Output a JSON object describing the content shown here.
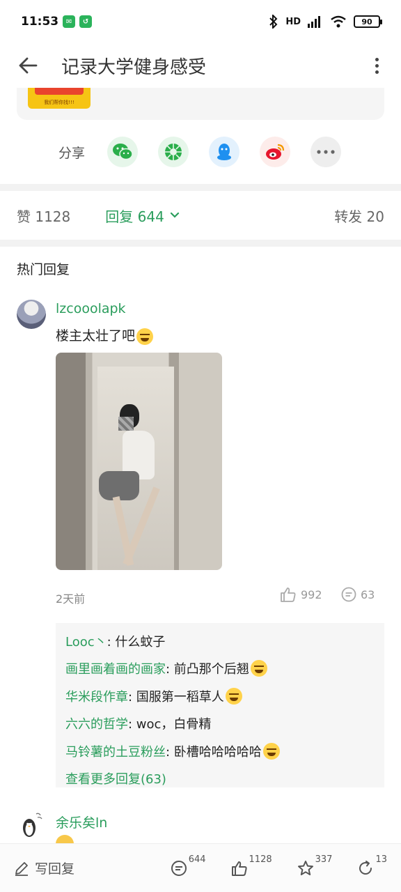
{
  "status_bar": {
    "time": "11:53",
    "network": "HD",
    "battery": "90"
  },
  "header": {
    "title": "记录大学健身感受"
  },
  "top_card": {
    "thumb_text": "我们帮你找!!!"
  },
  "share": {
    "label": "分享",
    "targets": [
      "wechat-icon",
      "moments-icon",
      "qq-icon",
      "weibo-icon",
      "more-icon"
    ]
  },
  "tabs": {
    "likes": "赞 1128",
    "replies": "回复 644",
    "forwards": "转发 20"
  },
  "section": {
    "hot_replies": "热门回复"
  },
  "comments": [
    {
      "username": "lzcooolapk",
      "text": "楼主太壮了吧",
      "time": "2天前",
      "likes": "992",
      "reply_count": "63",
      "replies": [
        {
          "name": "Looc丶",
          "text": ": 什么蚊子"
        },
        {
          "name": "画里画着画的画家",
          "text": ": 前凸那个后翘"
        },
        {
          "name": "华米段作章",
          "text": ": 国服第一稻草人"
        },
        {
          "name": "六六的哲学",
          "text": ": woc，白骨精"
        },
        {
          "name": "马铃薯的土豆粉丝",
          "text": ": 卧槽哈哈哈哈哈"
        }
      ],
      "view_more": "查看更多回复(63)"
    },
    {
      "username": "余乐矣ln"
    }
  ],
  "bottom_bar": {
    "write_reply": "写回复",
    "reply_count": "644",
    "like_count": "1128",
    "star_count": "337",
    "forward_count": "13"
  },
  "colors": {
    "accent": "#2a9d5c",
    "muted": "#888888"
  }
}
